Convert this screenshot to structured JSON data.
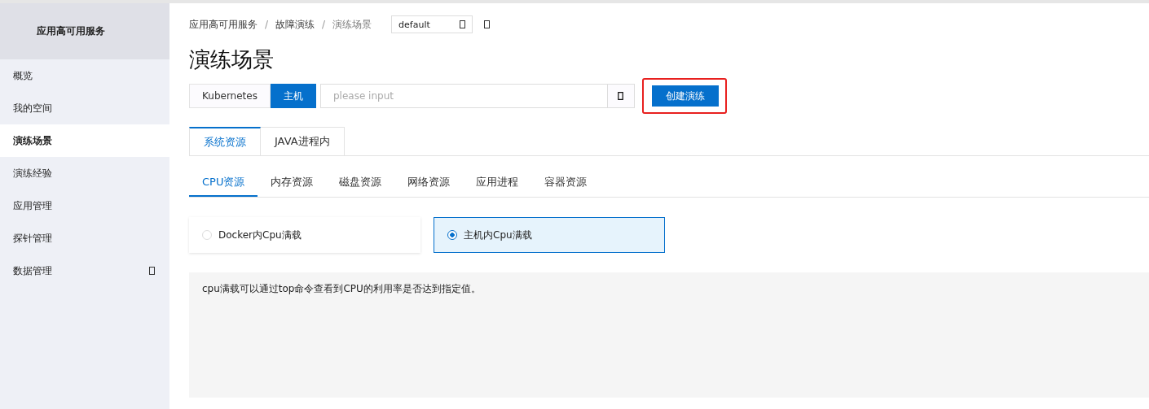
{
  "sidebar": {
    "title": "应用高可用服务",
    "items": [
      {
        "label": "概览",
        "selected": false,
        "has_icon": false
      },
      {
        "label": "我的空间",
        "selected": false,
        "has_icon": false
      },
      {
        "label": "演练场景",
        "selected": true,
        "has_icon": false
      },
      {
        "label": "演练经验",
        "selected": false,
        "has_icon": false
      },
      {
        "label": "应用管理",
        "selected": false,
        "has_icon": false
      },
      {
        "label": "探针管理",
        "selected": false,
        "has_icon": false
      },
      {
        "label": "数据管理",
        "selected": false,
        "has_icon": true
      }
    ]
  },
  "breadcrumb": [
    {
      "label": "应用高可用服务"
    },
    {
      "separator": "/",
      "label": "故障演练"
    },
    {
      "separator": "/",
      "label": "演练场景"
    }
  ],
  "namespace_select": {
    "value": "default"
  },
  "page_title": "演练场景",
  "platform_switch": [
    {
      "label": "Kubernetes",
      "selected": false
    },
    {
      "label": "主机",
      "selected": true
    }
  ],
  "search": {
    "placeholder": "please input"
  },
  "create_button": {
    "label": "创建演练",
    "highlighted": true
  },
  "tabs": [
    {
      "label": "系统资源",
      "selected": true
    },
    {
      "label": "JAVA进程内",
      "selected": false
    }
  ],
  "sub_tabs": [
    {
      "label": "CPU资源",
      "selected": true
    },
    {
      "label": "内存资源",
      "selected": false
    },
    {
      "label": "磁盘资源",
      "selected": false
    },
    {
      "label": "网络资源",
      "selected": false
    },
    {
      "label": "应用进程",
      "selected": false
    },
    {
      "label": "容器资源",
      "selected": false
    }
  ],
  "scenarios": [
    {
      "label": "Docker内Cpu满载",
      "selected": false
    },
    {
      "label": "主机内Cpu满载",
      "selected": true
    }
  ],
  "description": "cpu满载可以通过top命令查看到CPU的利用率是否达到指定值。"
}
